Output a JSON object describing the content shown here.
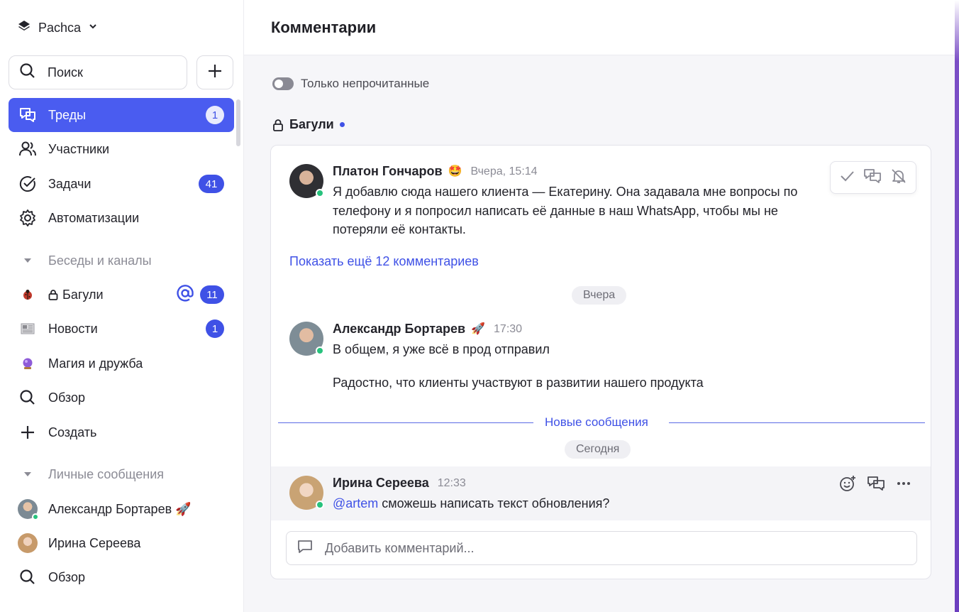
{
  "workspace": {
    "name": "Pachca"
  },
  "sidebar": {
    "search_label": "Поиск",
    "nav": [
      {
        "label": "Треды",
        "badge": "1"
      },
      {
        "label": "Участники"
      },
      {
        "label": "Задачи",
        "badge": "41"
      },
      {
        "label": "Автоматизации"
      }
    ],
    "channels_section": "Беседы и каналы",
    "channels": [
      {
        "label": "Багули",
        "badge": "11"
      },
      {
        "label": "Новости",
        "badge": "1"
      },
      {
        "label": "Магия и дружба"
      },
      {
        "label": "Обзор"
      },
      {
        "label": "Создать"
      }
    ],
    "dm_section": "Личные сообщения",
    "dms": [
      {
        "label": "Александр Бортарев 🚀"
      },
      {
        "label": "Ирина Сереева"
      },
      {
        "label": "Обзор"
      }
    ]
  },
  "main": {
    "title": "Комментарии",
    "toggle_label": "Только непрочитанные",
    "channel": "Багули",
    "thread": {
      "first": {
        "author": "Платон Гончаров",
        "time": "Вчера, 15:14",
        "lines": [
          "Я добавлю сюда нашего клиента — Екатерину. Она задавала мне вопросы по",
          "телефону и я попросил написать её данные в наш WhatsApp, чтобы мы не",
          "потеряли её контакты."
        ]
      },
      "show_more": "Показать ещё 12 комментариев",
      "date_yesterday": "Вчера",
      "second": {
        "author": "Александр Бортарев",
        "time": "17:30",
        "line1": "В общем, я уже всё в прод отправил",
        "line2": "Радостно, что клиенты участвуют в развитии нашего продукта"
      },
      "new_messages": "Новые сообщения",
      "date_today": "Сегодня",
      "third": {
        "author": "Ирина Сереева",
        "time": "12:33",
        "mention": "@artem",
        "text": " сможешь написать текст обновления?"
      }
    },
    "composer_placeholder": "Добавить комментарий..."
  },
  "colors": {
    "accent": "#4a5cf0",
    "online": "#27c27d",
    "link": "#3f51e6"
  }
}
